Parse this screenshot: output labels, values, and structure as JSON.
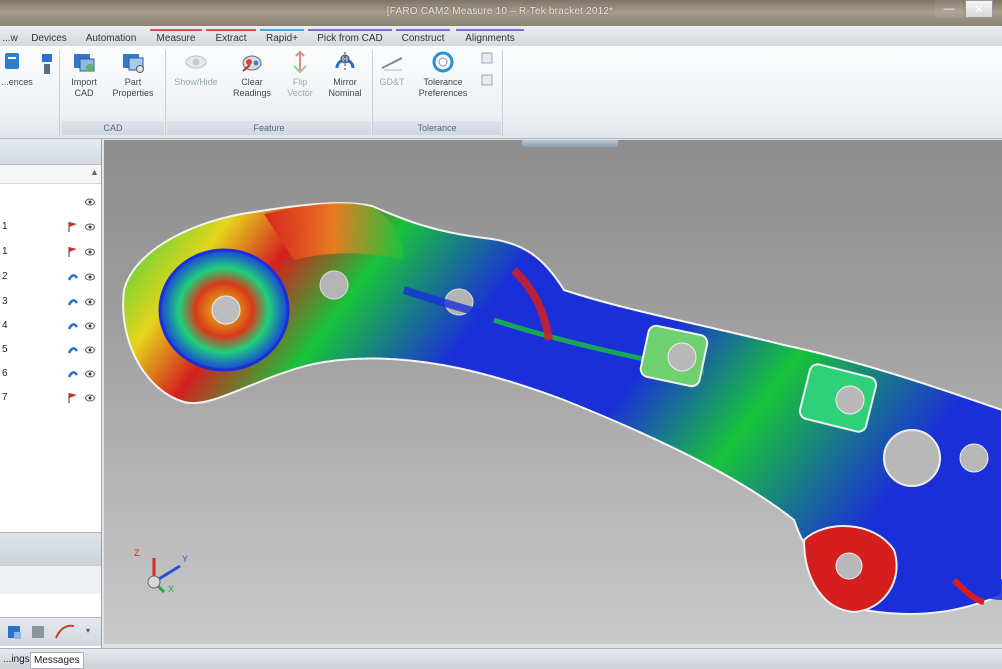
{
  "window": {
    "title": "[FARO CAM2 Measure 10 – R-Tek bracket 2012*"
  },
  "tabs": [
    {
      "label": "...w",
      "ctx": ""
    },
    {
      "label": "Devices",
      "ctx": ""
    },
    {
      "label": "Automation",
      "ctx": ""
    },
    {
      "label": "Measure",
      "ctx": "ctx"
    },
    {
      "label": "Extract",
      "ctx": "ctx"
    },
    {
      "label": "Rapid+",
      "ctx": "ctx3"
    },
    {
      "label": "Pick from CAD",
      "ctx": "ctx2"
    },
    {
      "label": "Construct",
      "ctx": "ctx2"
    },
    {
      "label": "Alignments",
      "ctx": "ctx2"
    }
  ],
  "ribbon": {
    "references_label": "...ences",
    "import_cad_label": "Import CAD",
    "part_properties_label": "Part Properties",
    "group_cad": "CAD",
    "show_hide_label": "Show/Hide",
    "clear_readings_label": "Clear Readings",
    "flip_vector_label": "Flip Vector",
    "mirror_nominal_label": "Mirror Nominal",
    "group_feature": "Feature",
    "gdt_label": "GD&T",
    "tolerance_preferences_label": "Tolerance Preferences",
    "group_tolerance": "Tolerance"
  },
  "tree": {
    "rows": [
      {
        "label": "",
        "flag": "none"
      },
      {
        "label": "1",
        "flag": "red"
      },
      {
        "label": "1",
        "flag": "red"
      },
      {
        "label": "2",
        "flag": "blue"
      },
      {
        "label": "3",
        "flag": "blue"
      },
      {
        "label": "4",
        "flag": "blue"
      },
      {
        "label": "5",
        "flag": "blue"
      },
      {
        "label": "6",
        "flag": "blue"
      },
      {
        "label": "7",
        "flag": "red"
      }
    ]
  },
  "status": {
    "tab_ings": "...ings",
    "tab_messages": "Messages"
  },
  "axes": {
    "x": "X",
    "y": "Y",
    "z": "Z"
  },
  "colors": {
    "flag_red": "#d42a2a",
    "flag_blue": "#2a6fd4",
    "deviation_high": "#d51f1f",
    "deviation_mid": "#18c43a",
    "deviation_low": "#1a2fd8"
  }
}
